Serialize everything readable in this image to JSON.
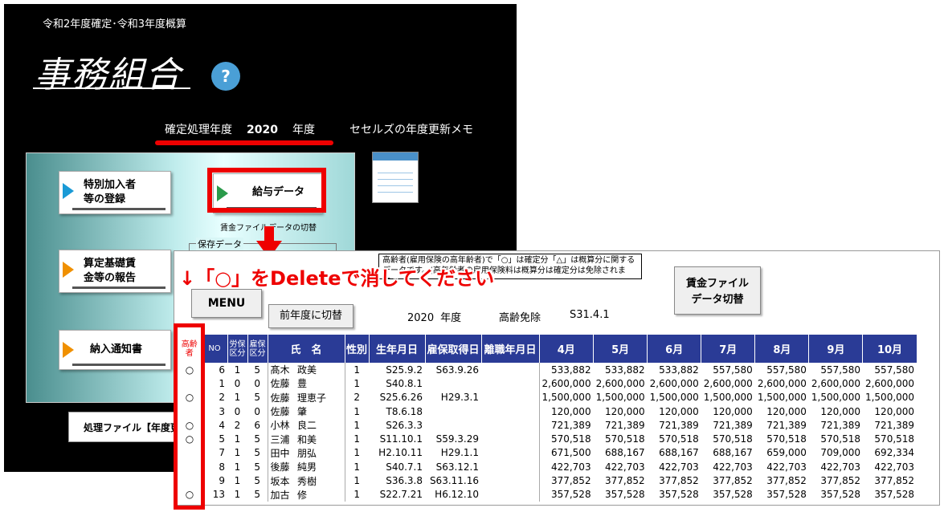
{
  "menu_window": {
    "period": "令和2年度確定･令和3年度概算",
    "app_title": "事務組合",
    "help_icon": "?",
    "year_label": "確定処理年度",
    "year_value": "2020",
    "year_suffix": "年度",
    "memo_label": "セセルズの年度更新メモ",
    "buttons": [
      {
        "label_1": "特別加入者",
        "label_2": "等の登録",
        "icon": "blue-arrow-icon"
      },
      {
        "label_1": "給与データ",
        "label_2": "",
        "icon": "green-arrow-icon"
      },
      {
        "label_1": "算定基礎賃",
        "label_2": "金等の報告",
        "icon": "orange-arrow-icon"
      },
      {
        "label_1": "納入通知書",
        "label_2": "",
        "icon": "orange-arrow-icon"
      }
    ],
    "kyuyo_note": "賃金ファイルデータの切替",
    "hozon_label": "保存データ",
    "proc_button": "処理ファイル【年度更"
  },
  "sheet": {
    "tip": "高齢者(雇用保険の高年齢者)で「○」は確定分「△」は概算分に関するデータです。(高年齢者の雇用保険料は概算分は確定分は免除されます。",
    "instruction": "↓「○」をDeleteで消してください",
    "menu_button": "MENU",
    "prev_year_button": "前年度に切替",
    "year": "2020",
    "year_unit": "年度",
    "menjo_label": "高齢免除",
    "menjo_date": "S31.4.1",
    "file_button_1": "賃金ファイル",
    "file_button_2": "データ切替",
    "headers": {
      "elder": "高齢者",
      "no": "NO",
      "rouho": "労保区分",
      "koho": "雇保区分",
      "name": "氏　名",
      "sex": "性別",
      "birth": "生年月日",
      "acquired": "雇保取得日",
      "left": "離職年月日",
      "months": [
        "4月",
        "5月",
        "6月",
        "7月",
        "8月",
        "9月",
        "10月"
      ]
    },
    "rows": [
      {
        "elder": "○",
        "no": "6",
        "rouho": "1",
        "koho": "5",
        "surname": "髙木",
        "given": "政美",
        "sex": "1",
        "birth": "S25.9.2",
        "acquired": "S63.9.26",
        "left": "",
        "m": [
          "533,882",
          "533,882",
          "533,882",
          "557,580",
          "557,580",
          "557,580",
          "557,580"
        ]
      },
      {
        "elder": "",
        "no": "1",
        "rouho": "0",
        "koho": "0",
        "surname": "佐藤",
        "given": "豊",
        "sex": "1",
        "birth": "S40.8.1",
        "acquired": "",
        "left": "",
        "m": [
          "2,600,000",
          "2,600,000",
          "2,600,000",
          "2,600,000",
          "2,600,000",
          "2,600,000",
          "2,600,000"
        ]
      },
      {
        "elder": "○",
        "no": "2",
        "rouho": "1",
        "koho": "5",
        "surname": "佐藤",
        "given": "理恵子",
        "sex": "2",
        "birth": "S25.6.26",
        "acquired": "H29.3.1",
        "left": "",
        "m": [
          "1,500,000",
          "1,500,000",
          "1,500,000",
          "1,500,000",
          "1,500,000",
          "1,500,000",
          "1,500,000"
        ]
      },
      {
        "elder": "",
        "no": "3",
        "rouho": "0",
        "koho": "0",
        "surname": "佐藤",
        "given": "肇",
        "sex": "1",
        "birth": "T8.6.18",
        "acquired": "",
        "left": "",
        "m": [
          "120,000",
          "120,000",
          "120,000",
          "120,000",
          "120,000",
          "120,000",
          "120,000"
        ]
      },
      {
        "elder": "○",
        "no": "4",
        "rouho": "2",
        "koho": "6",
        "surname": "小林",
        "given": "良二",
        "sex": "1",
        "birth": "S26.3.3",
        "acquired": "",
        "left": "",
        "m": [
          "721,389",
          "721,389",
          "721,389",
          "721,389",
          "721,389",
          "721,389",
          "721,389"
        ]
      },
      {
        "elder": "○",
        "no": "5",
        "rouho": "1",
        "koho": "5",
        "surname": "三浦",
        "given": "和美",
        "sex": "1",
        "birth": "S11.10.1",
        "acquired": "S59.3.29",
        "left": "",
        "m": [
          "570,518",
          "570,518",
          "570,518",
          "570,518",
          "570,518",
          "570,518",
          "570,518"
        ]
      },
      {
        "elder": "",
        "no": "7",
        "rouho": "1",
        "koho": "5",
        "surname": "田中",
        "given": "朋弘",
        "sex": "1",
        "birth": "H2.10.11",
        "acquired": "H29.1.1",
        "left": "",
        "m": [
          "671,500",
          "688,167",
          "688,167",
          "688,167",
          "659,000",
          "709,000",
          "692,334"
        ]
      },
      {
        "elder": "",
        "no": "8",
        "rouho": "1",
        "koho": "5",
        "surname": "後藤",
        "given": "純男",
        "sex": "1",
        "birth": "S40.7.1",
        "acquired": "S63.12.1",
        "left": "",
        "m": [
          "422,703",
          "422,703",
          "422,703",
          "422,703",
          "422,703",
          "422,703",
          "422,703"
        ]
      },
      {
        "elder": "",
        "no": "9",
        "rouho": "1",
        "koho": "5",
        "surname": "坂本",
        "given": "秀樹",
        "sex": "1",
        "birth": "S36.3.8",
        "acquired": "S63.11.16",
        "left": "",
        "m": [
          "377,852",
          "377,852",
          "377,852",
          "377,852",
          "377,852",
          "377,852",
          "377,852"
        ]
      },
      {
        "elder": "○",
        "no": "13",
        "rouho": "1",
        "koho": "5",
        "surname": "加古",
        "given": "修",
        "sex": "1",
        "birth": "S22.7.21",
        "acquired": "H6.12.10",
        "left": "",
        "m": [
          "357,528",
          "357,528",
          "357,528",
          "357,528",
          "357,528",
          "357,528",
          "357,528"
        ]
      }
    ]
  }
}
